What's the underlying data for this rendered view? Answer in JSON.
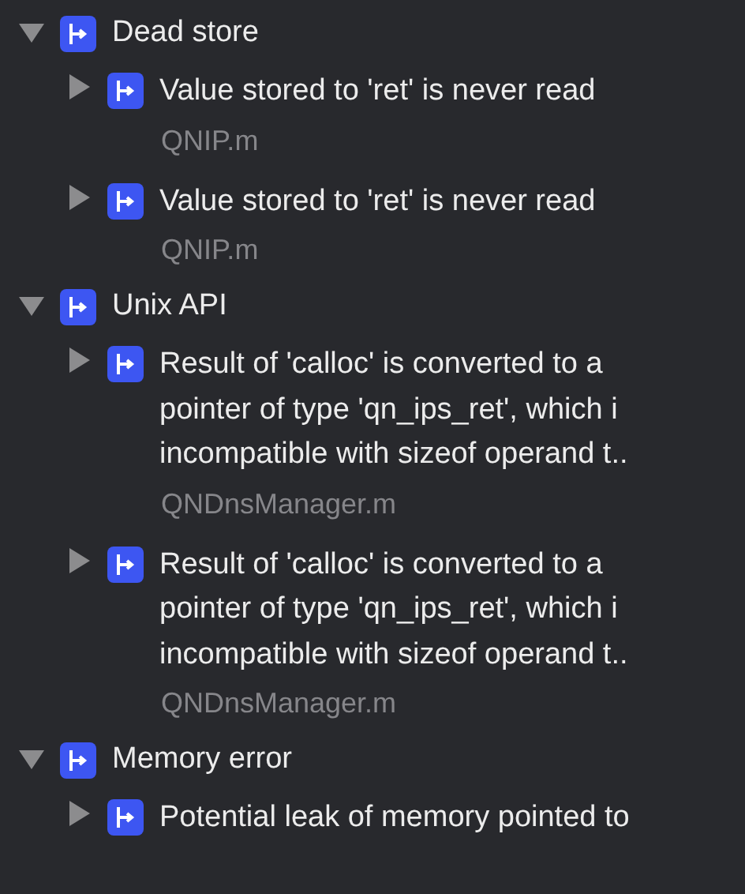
{
  "groups": [
    {
      "title": "Dead store",
      "expanded": true,
      "items": [
        {
          "lines": [
            "Value stored to 'ret' is never read"
          ],
          "file": "QNIP.m",
          "expanded": false
        },
        {
          "lines": [
            "Value stored to 'ret' is never read"
          ],
          "file": "QNIP.m",
          "expanded": false
        }
      ]
    },
    {
      "title": "Unix API",
      "expanded": true,
      "items": [
        {
          "lines": [
            "Result of 'calloc' is converted to a",
            "pointer of type 'qn_ips_ret', which i",
            "incompatible with sizeof operand t.."
          ],
          "file": "QNDnsManager.m",
          "expanded": false
        },
        {
          "lines": [
            "Result of 'calloc' is converted to a",
            "pointer of type 'qn_ips_ret', which i",
            "incompatible with sizeof operand t.."
          ],
          "file": "QNDnsManager.m",
          "expanded": false
        }
      ]
    },
    {
      "title": "Memory error",
      "expanded": true,
      "items": [
        {
          "lines": [
            "Potential leak of memory pointed to"
          ],
          "expanded": false
        }
      ]
    }
  ]
}
